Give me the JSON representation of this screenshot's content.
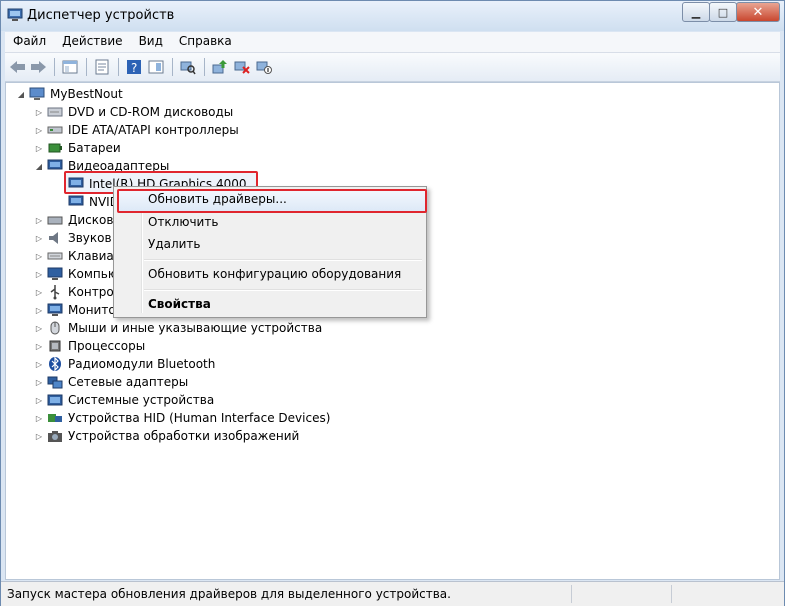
{
  "window": {
    "title": "Диспетчер устройств"
  },
  "menubar": [
    "Файл",
    "Действие",
    "Вид",
    "Справка"
  ],
  "tree": {
    "root": "MyBestNout",
    "categories": [
      "DVD и CD-ROM дисководы",
      "IDE ATA/ATAPI контроллеры",
      "Батареи",
      "Видеоадаптеры",
      "Дисков",
      "Звуков",
      "Клавиат",
      "Компью",
      "Контрол",
      "Монито",
      "Мыши и иные указывающие устройства",
      "Процессоры",
      "Радиомодули Bluetooth",
      "Сетевые адаптеры",
      "Системные устройства",
      "Устройства HID (Human Interface Devices)",
      "Устройства обработки изображений"
    ],
    "video_children": [
      "Intel(R) HD Graphics 4000",
      "NVID"
    ]
  },
  "context_menu": {
    "update_drivers": "Обновить драйверы...",
    "disable": "Отключить",
    "delete": "Удалить",
    "scan_hardware": "Обновить конфигурацию оборудования",
    "properties": "Свойства"
  },
  "statusbar": {
    "text": "Запуск мастера обновления драйверов для выделенного устройства."
  }
}
